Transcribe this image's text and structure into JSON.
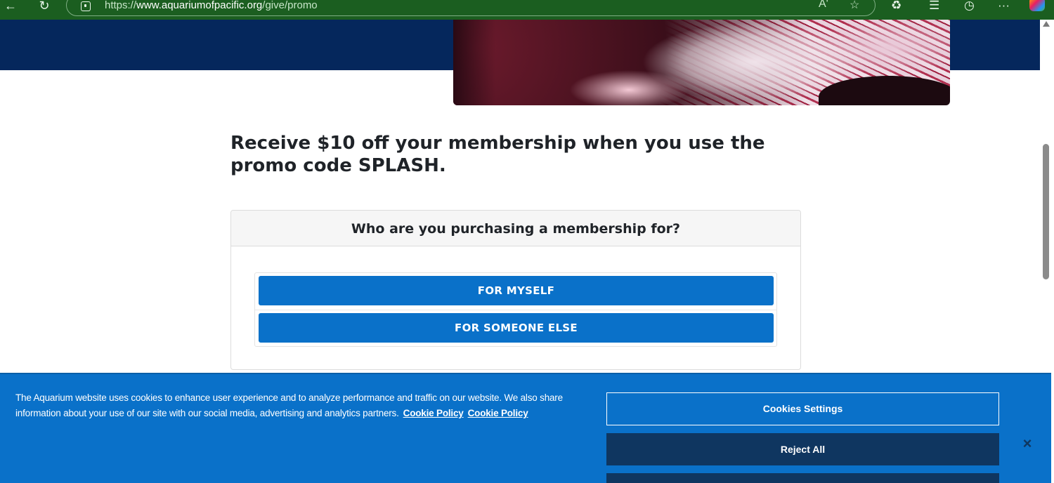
{
  "browser": {
    "url_prefix": "https://",
    "url_domain": "www.aquariumofpacific.org",
    "url_path": "/give/promo",
    "icons": [
      "back-icon",
      "refresh-icon",
      "lock-icon",
      "read-aloud-icon",
      "favorite-star-icon",
      "extensions-icon",
      "favorites-icon",
      "history-icon",
      "more-icon",
      "copilot-icon"
    ],
    "read_aloud_glyph": "Aʹ",
    "more_glyph": "···"
  },
  "promo": {
    "heading": "Receive $10 off your membership when you use the promo code SPLASH."
  },
  "membership": {
    "question": "Who are you purchasing a membership for?",
    "options": [
      {
        "label": "FOR MYSELF"
      },
      {
        "label": "FOR SOMEONE ELSE"
      }
    ]
  },
  "cookie_banner": {
    "text": "The Aquarium website uses cookies to enhance user experience and to analyze performance and traffic on our website. We also share information about your use of our site with our social media, advertising and analytics partners.",
    "links": [
      "Cookie Policy",
      "Cookie Policy"
    ],
    "settings_label": "Cookies Settings",
    "reject_label": "Reject All",
    "close_glyph": "×"
  },
  "colors": {
    "browser_bar": "#1b5e20",
    "hero_band": "#05275c",
    "primary_button": "#0a71c9",
    "cookie_banner": "#0a71c9",
    "reject_button": "#0f3660"
  }
}
